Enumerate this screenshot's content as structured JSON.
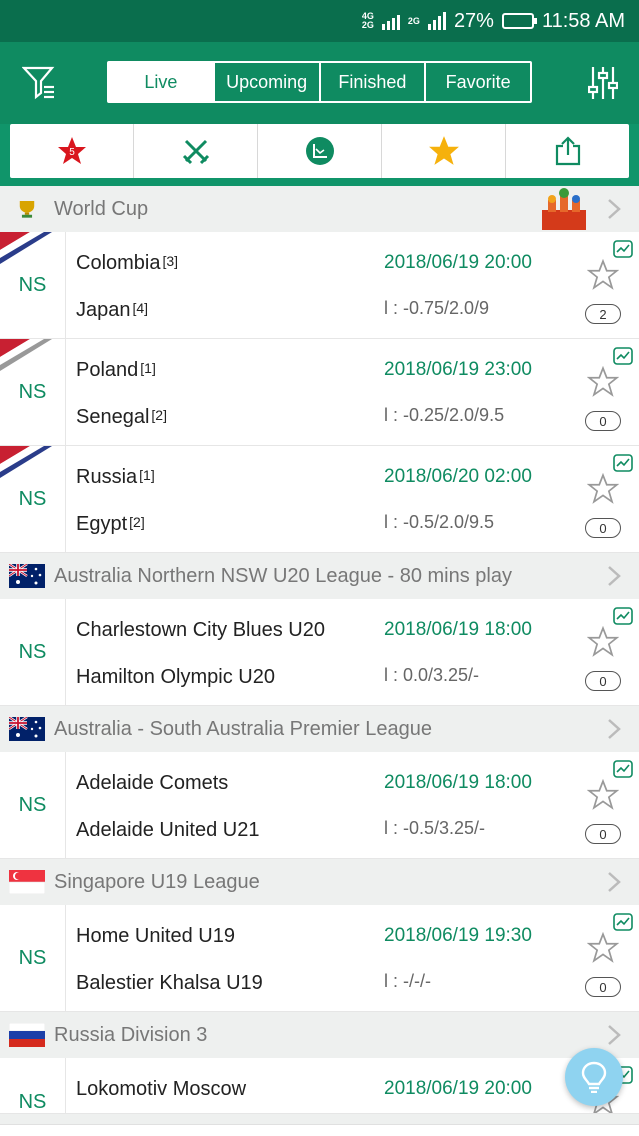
{
  "status": {
    "net_top": "4G",
    "net_bottom": "2G",
    "net2": "2G",
    "battery": "27%",
    "time": "11:58 AM"
  },
  "tabs": [
    {
      "label": "Live",
      "active": true
    },
    {
      "label": "Upcoming",
      "active": false
    },
    {
      "label": "Finished",
      "active": false
    },
    {
      "label": "Favorite",
      "active": false
    }
  ],
  "toolbar": {
    "hot_badge": "5"
  },
  "colors": {
    "accent": "#0f8b61",
    "header": "#0f8b61",
    "statusbar": "#0a6e4d",
    "fab": "#8fd3f0"
  },
  "leagues": [
    {
      "name": "World Cup",
      "flag": "trophy-icon",
      "matches": [
        {
          "status": "NS",
          "home": "Colombia",
          "home_rank": "[3]",
          "away": "Japan",
          "away_rank": "[4]",
          "time": "2018/06/19 20:00",
          "odds": "l : -0.75/2.0/9",
          "count": "2"
        },
        {
          "status": "NS",
          "home": "Poland",
          "home_rank": "[1]",
          "away": "Senegal",
          "away_rank": "[2]",
          "time": "2018/06/19 23:00",
          "odds": "l : -0.25/2.0/9.5",
          "count": "0"
        },
        {
          "status": "NS",
          "home": "Russia",
          "home_rank": "[1]",
          "away": "Egypt",
          "away_rank": "[2]",
          "time": "2018/06/20 02:00",
          "odds": "l : -0.5/2.0/9.5",
          "count": "0"
        }
      ]
    },
    {
      "name": "Australia Northern NSW U20 League - 80 mins play",
      "flag": "australia-flag-icon",
      "matches": [
        {
          "status": "NS",
          "home": "Charlestown City Blues U20",
          "away": "Hamilton Olympic U20",
          "time": "2018/06/19 18:00",
          "odds": "l : 0.0/3.25/-",
          "count": "0"
        }
      ]
    },
    {
      "name": "Australia - South Australia Premier League",
      "flag": "australia-flag-icon",
      "matches": [
        {
          "status": "NS",
          "home": "Adelaide Comets",
          "away": "Adelaide United U21",
          "time": "2018/06/19 18:00",
          "odds": "l : -0.5/3.25/-",
          "count": "0"
        }
      ]
    },
    {
      "name": "Singapore U19 League",
      "flag": "singapore-flag-icon",
      "matches": [
        {
          "status": "NS",
          "home": "Home United U19",
          "away": "Balestier Khalsa U19",
          "time": "2018/06/19 19:30",
          "odds": "l : -/-/-",
          "count": "0"
        }
      ]
    },
    {
      "name": "Russia Division 3",
      "flag": "russia-flag-icon",
      "matches": [
        {
          "status": "NS",
          "home": "Lokomotiv Moscow",
          "away": "",
          "time": "2018/06/19 20:00",
          "odds": "",
          "count": ""
        }
      ]
    }
  ]
}
